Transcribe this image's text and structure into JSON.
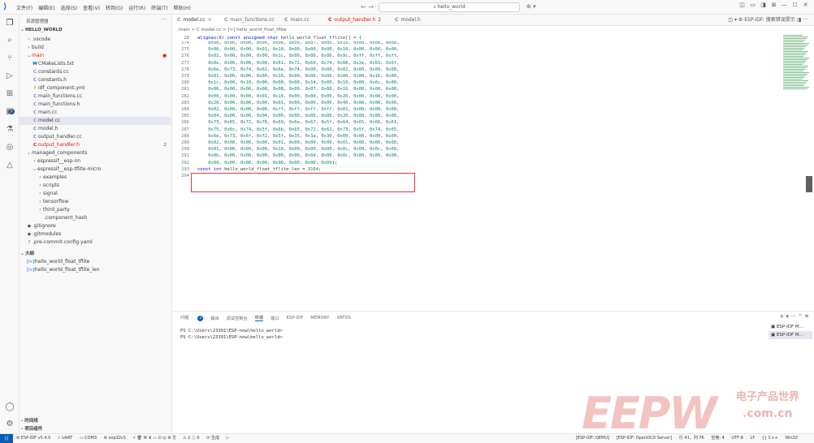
{
  "titlebar": {
    "menus": [
      "文件(F)",
      "编辑(E)",
      "选择(S)",
      "查看(V)",
      "转到(G)",
      "运行(R)",
      "终端(T)",
      "帮助(H)"
    ],
    "search_text": "hello_world"
  },
  "sidebar": {
    "title": "资源管理器",
    "section": "HELLO_WORLD",
    "items": [
      {
        "label": ".vscode",
        "indent": 1,
        "kind": "folder",
        "open": false
      },
      {
        "label": "build",
        "indent": 1,
        "kind": "folder",
        "open": false
      },
      {
        "label": "main",
        "indent": 1,
        "kind": "folder",
        "open": true,
        "red": true,
        "mark": "●"
      },
      {
        "label": "CMakeLists.txt",
        "indent": 2,
        "icon": "M",
        "icon_class": "ic-m"
      },
      {
        "label": "constants.cc",
        "indent": 2,
        "icon": "C",
        "icon_class": "ic-cc"
      },
      {
        "label": "constants.h",
        "indent": 2,
        "icon": "C",
        "icon_class": "ic-h"
      },
      {
        "label": "idf_component.yml",
        "indent": 2,
        "icon": "!",
        "icon_class": "ic-y"
      },
      {
        "label": "main_functions.cc",
        "indent": 2,
        "icon": "C",
        "icon_class": "ic-cc"
      },
      {
        "label": "main_functions.h",
        "indent": 2,
        "icon": "C",
        "icon_class": "ic-h"
      },
      {
        "label": "main.cc",
        "indent": 2,
        "icon": "C",
        "icon_class": "ic-cc"
      },
      {
        "label": "model.cc",
        "indent": 2,
        "icon": "C",
        "icon_class": "ic-cc",
        "selected": true
      },
      {
        "label": "model.h",
        "indent": 2,
        "icon": "C",
        "icon_class": "ic-h"
      },
      {
        "label": "output_handler.cc",
        "indent": 2,
        "icon": "C",
        "icon_class": "ic-cc"
      },
      {
        "label": "output_handler.h",
        "indent": 2,
        "icon": "C",
        "icon_class": "ic-r",
        "red": true,
        "mark": "2"
      },
      {
        "label": "managed_components",
        "indent": 1,
        "kind": "folder",
        "open": true
      },
      {
        "label": "espressif__esp-nn",
        "indent": 2,
        "kind": "folder",
        "open": false
      },
      {
        "label": "espressif__esp-tflite-micro",
        "indent": 2,
        "kind": "folder",
        "open": true
      },
      {
        "label": "examples",
        "indent": 3,
        "kind": "folder",
        "open": false
      },
      {
        "label": "scripts",
        "indent": 3,
        "kind": "folder",
        "open": false
      },
      {
        "label": "signal",
        "indent": 3,
        "kind": "folder",
        "open": false
      },
      {
        "label": "tensorflow",
        "indent": 3,
        "kind": "folder",
        "open": false
      },
      {
        "label": "third_party",
        "indent": 3,
        "kind": "folder",
        "open": false
      },
      {
        "label": ".component_hash",
        "indent": 3,
        "icon": "",
        "icon_class": "ic-g"
      },
      {
        "label": ".gitignore",
        "indent": 1,
        "icon": "◆",
        "icon_class": "ic-g"
      },
      {
        "label": ".gitmodules",
        "indent": 1,
        "icon": "◆",
        "icon_class": "ic-g"
      },
      {
        "label": ".pre-commit-config.yaml",
        "indent": 1,
        "icon": "!",
        "icon_class": "ic-y"
      }
    ],
    "outline_title": "大纲",
    "outline_items": [
      "hello_world_float_tflite",
      "hello_world_float_tflite_len"
    ],
    "timeline_title": "时间线",
    "project_title": "项目组件"
  },
  "tabs": [
    {
      "label": "model.cc",
      "icon": "C",
      "active": true,
      "close": "×"
    },
    {
      "label": "main_functions.cc",
      "icon": "C"
    },
    {
      "label": "main.cc",
      "icon": "C"
    },
    {
      "label": "output_handler.h",
      "icon": "C",
      "red": true,
      "mark": "2"
    },
    {
      "label": "model.h",
      "icon": "C"
    }
  ],
  "tab_actions": "ESP-IDF: 搜索错误提示",
  "breadcrumb": "main > C model.cc > [∞] hello_world_float_tflite",
  "editor": {
    "sticky": {
      "num": "28",
      "text": "alignas(8) const unsigned char hello_world_float_tflite[] = {"
    },
    "lines": [
      {
        "num": "274",
        "text": "    0x00, 0x00, 0x00, 0x00, 0x00, 0x00, 0x07, 0x00, 0x16, 0x00, 0x00, 0x00,"
      },
      {
        "num": "275",
        "text": "    0x00, 0x00, 0x00, 0x01, 0x10, 0x00, 0x00, 0x00, 0x10, 0x00, 0x00, 0x00,"
      },
      {
        "num": "276",
        "text": "    0x02, 0x00, 0x00, 0x00, 0x1c, 0x00, 0x00, 0x00, 0x9c, 0xff, 0xff, 0xff,"
      },
      {
        "num": "277",
        "text": "    0x0e, 0x00, 0x00, 0x00, 0x61, 0x72, 0x69, 0x74, 0x68, 0x2e, 0x63, 0x6f,"
      },
      {
        "num": "278",
        "text": "    0x6e, 0x73, 0x74, 0x61, 0x6e, 0x74, 0x00, 0x00, 0x02, 0x00, 0x00, 0x00,"
      },
      {
        "num": "279",
        "text": "    0x01, 0x00, 0x00, 0x00, 0x10, 0x00, 0x00, 0x00, 0x00, 0x00, 0x16, 0x00,"
      },
      {
        "num": "280",
        "text": "    0x1c, 0x00, 0x18, 0x00, 0x00, 0x00, 0x14, 0x00, 0x10, 0x00, 0x0c, 0x00,"
      },
      {
        "num": "281",
        "text": "    0x00, 0x00, 0x00, 0x00, 0x08, 0x00, 0x07, 0x00, 0x16, 0x00, 0x00, 0x00,"
      },
      {
        "num": "282",
        "text": "    0x00, 0x00, 0x00, 0x01, 0x14, 0x00, 0x00, 0x00, 0x20, 0x00, 0x00, 0x00,"
      },
      {
        "num": "283",
        "text": "    0x20, 0x00, 0x00, 0x00, 0x01, 0x00, 0x00, 0x00, 0x40, 0x00, 0x00, 0x00,"
      },
      {
        "num": "284",
        "text": "    0x02, 0x00, 0x00, 0x00, 0xff, 0xff, 0xff, 0xff, 0x01, 0x00, 0x00, 0x00,"
      },
      {
        "num": "285",
        "text": "    0x04, 0x00, 0x00, 0x04, 0x00, 0x00, 0x00, 0x00, 0x20, 0x00, 0x00, 0x00,"
      },
      {
        "num": "286",
        "text": "    0x73, 0x65, 0x72, 0x76, 0x69, 0x6e, 0x67, 0x5f, 0x64, 0x65, 0x66, 0x61,"
      },
      {
        "num": "287",
        "text": "    0x75, 0x6c, 0x74, 0x5f, 0x6b, 0x65, 0x72, 0x61, 0x73, 0x5f, 0x74, 0x65,"
      },
      {
        "num": "288",
        "text": "    0x6e, 0x73, 0x6f, 0x72, 0x5f, 0x35, 0x3a, 0x30, 0x00, 0x00, 0x00, 0x00,"
      },
      {
        "num": "289",
        "text": "    0x02, 0x00, 0x00, 0x00, 0x01, 0x00, 0x00, 0x00, 0x01, 0x00, 0x00, 0x00,"
      },
      {
        "num": "290",
        "text": "    0x01, 0x00, 0x00, 0x00, 0x10, 0x00, 0x00, 0x00, 0x0c, 0x00, 0x0c, 0x00,"
      },
      {
        "num": "291",
        "text": "    0x0b, 0x00, 0x00, 0x00, 0x00, 0x00, 0x04, 0x00, 0x0c, 0x00, 0x00, 0x00,"
      },
      {
        "num": "292",
        "text": "    0x09, 0x00, 0x00, 0x00, 0x00, 0x00, 0x00, 0x09};"
      },
      {
        "num": "293",
        "text": "const int hello_world_float_tflite_len = 3164;"
      },
      {
        "num": "294",
        "text": ""
      }
    ]
  },
  "panel": {
    "tabs": [
      "问题",
      "输出",
      "调试控制台",
      "终端",
      "端口",
      "ESP-IDF",
      "MEMORY",
      "XRTOS"
    ],
    "problems_count": "2",
    "active_tab": "终端",
    "terminal_lines": [
      "PS C:\\Users\\23391\\ESP-now\\hello_world>",
      "PS C:\\Users\\23391\\ESP-now\\hello_world>"
    ],
    "terminal_list": [
      "ESP-IDF M...",
      "ESP-IDF M..."
    ]
  },
  "statusbar": {
    "left": [
      "⊗ ESP-IDF v5.4.0",
      "⚡ UART",
      "▭ COM3",
      "⚙ esp32s3",
      "⚠ 2  ⓘ 0",
      "⟳ 生成"
    ],
    "right": [
      "[ESP-IDF: QEMU]",
      "[ESP-IDF: OpenOCD Server]",
      "行 41，列 76",
      "空格: 4",
      "UTF-8",
      "LF",
      "{} C++",
      "Win32"
    ]
  },
  "watermark": {
    "brand": "EEPW",
    "chinese": "电子产品世界",
    "domain": ".com.cn"
  },
  "colors": {
    "accent": "#005fb8",
    "hex": "#098658",
    "keyword": "#0000ff",
    "highlight": "#e0363b",
    "error": "#e51400"
  }
}
